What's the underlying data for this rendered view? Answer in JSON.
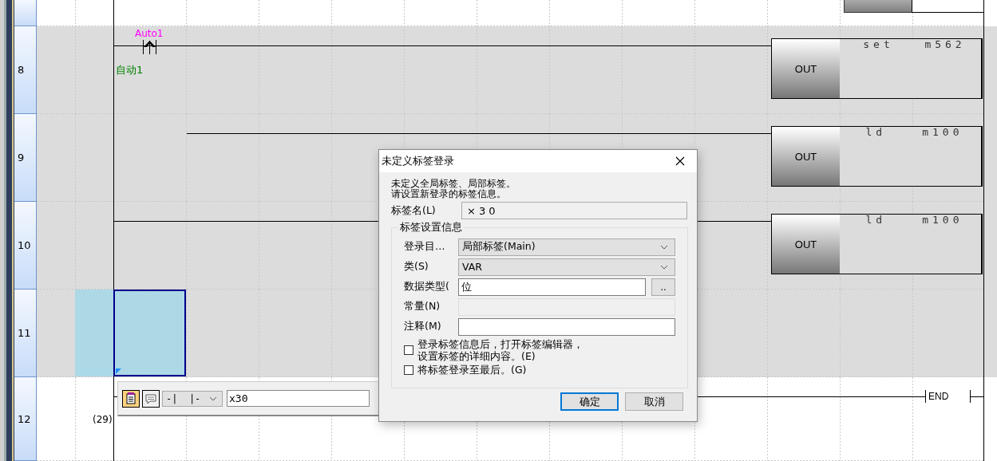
{
  "ladder": {
    "rows": [
      {
        "number": "",
        "kind": "partial"
      },
      {
        "number": "8",
        "kind": "contact",
        "contact": {
          "label": "Auto1",
          "comment": "自动1"
        },
        "coil": {
          "name": "OUT",
          "operands": [
            "set",
            "m562"
          ]
        }
      },
      {
        "number": "9",
        "kind": "branch",
        "coil": {
          "name": "OUT",
          "operands": [
            "ld",
            "m100"
          ]
        }
      },
      {
        "number": "10",
        "kind": "rung",
        "coil": {
          "name": "OUT",
          "operands": [
            "ld",
            "m100"
          ]
        }
      },
      {
        "number": "11",
        "kind": "empty",
        "selected": true
      },
      {
        "number": "12",
        "kind": "end",
        "step": "(29)",
        "instruction": "END"
      }
    ]
  },
  "editor_bar": {
    "symbol": "-|  |-",
    "value": "x30"
  },
  "dialog": {
    "title": "未定义标签登录",
    "message": [
      "未定义全局标签、局部标签。",
      "请设置新登录的标签信息。"
    ],
    "name_field": {
      "label": "标签名(L)",
      "value": "×30"
    },
    "group": {
      "title": "标签设置信息",
      "fields": [
        {
          "kind": "select",
          "label": "登录目…",
          "value": "局部标签(Main)"
        },
        {
          "kind": "select",
          "label": "类(S)",
          "value": "VAR"
        },
        {
          "kind": "browse",
          "label": "数据类型(",
          "value": "位",
          "button": ".."
        },
        {
          "kind": "disabled",
          "label": "常量(N)"
        },
        {
          "kind": "input",
          "label": "注释(M)"
        }
      ],
      "checkboxes": [
        {
          "lines": [
            "登录标签信息后，打开标签编辑器，",
            "设置标签的详细内容。(E)"
          ],
          "checked": false
        },
        {
          "lines": [
            "将标签登录至最后。(G)"
          ],
          "checked": false
        }
      ]
    },
    "buttons": [
      {
        "label": "确定",
        "default": true
      },
      {
        "label": "取消",
        "default": false
      }
    ]
  }
}
